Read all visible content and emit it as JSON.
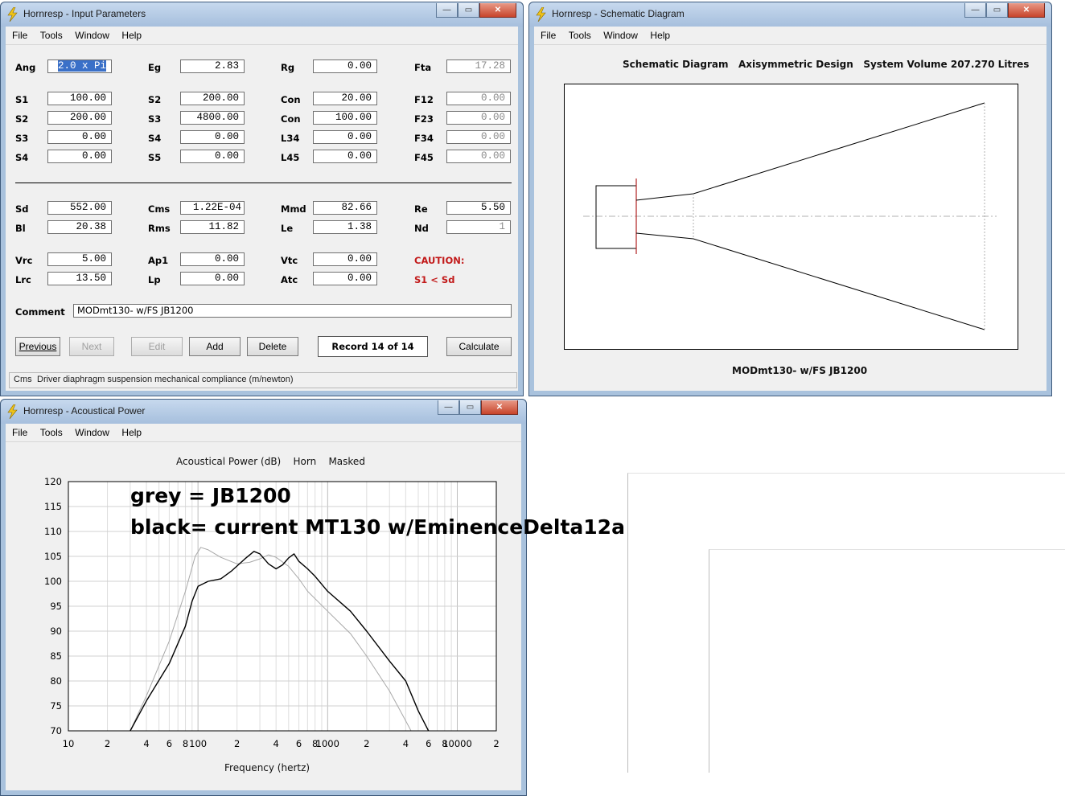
{
  "menu": [
    "File",
    "Tools",
    "Window",
    "Help"
  ],
  "window_buttons": {
    "minimize": "—",
    "maximize": "▭",
    "close": "✕"
  },
  "input_window": {
    "title": "Hornresp - Input Parameters",
    "fields": {
      "ang": {
        "label": "Ang",
        "value": "2.0 x Pi"
      },
      "eg": {
        "label": "Eg",
        "value": "2.83"
      },
      "rg": {
        "label": "Rg",
        "value": "0.00"
      },
      "fta": {
        "label": "Fta",
        "value": "17.28"
      },
      "s1": {
        "label": "S1",
        "value": "100.00"
      },
      "s2a": {
        "label": "S2",
        "value": "200.00"
      },
      "con1": {
        "label": "Con",
        "value": "20.00"
      },
      "f12": {
        "label": "F12",
        "value": "0.00"
      },
      "s2b": {
        "label": "S2",
        "value": "200.00"
      },
      "s3a": {
        "label": "S3",
        "value": "4800.00"
      },
      "con2": {
        "label": "Con",
        "value": "100.00"
      },
      "f23": {
        "label": "F23",
        "value": "0.00"
      },
      "s3b": {
        "label": "S3",
        "value": "0.00"
      },
      "s4a": {
        "label": "S4",
        "value": "0.00"
      },
      "l34": {
        "label": "L34",
        "value": "0.00"
      },
      "f34": {
        "label": "F34",
        "value": "0.00"
      },
      "s4b": {
        "label": "S4",
        "value": "0.00"
      },
      "s5": {
        "label": "S5",
        "value": "0.00"
      },
      "l45": {
        "label": "L45",
        "value": "0.00"
      },
      "f45": {
        "label": "F45",
        "value": "0.00"
      },
      "sd": {
        "label": "Sd",
        "value": "552.00"
      },
      "cms": {
        "label": "Cms",
        "value": "1.22E-04"
      },
      "mmd": {
        "label": "Mmd",
        "value": "82.66"
      },
      "re": {
        "label": "Re",
        "value": "5.50"
      },
      "bl": {
        "label": "Bl",
        "value": "20.38"
      },
      "rms": {
        "label": "Rms",
        "value": "11.82"
      },
      "le": {
        "label": "Le",
        "value": "1.38"
      },
      "nd": {
        "label": "Nd",
        "value": "1"
      },
      "vrc": {
        "label": "Vrc",
        "value": "5.00"
      },
      "ap1": {
        "label": "Ap1",
        "value": "0.00"
      },
      "vtc": {
        "label": "Vtc",
        "value": "0.00"
      },
      "lrc": {
        "label": "Lrc",
        "value": "13.50"
      },
      "lp": {
        "label": "Lp",
        "value": "0.00"
      },
      "atc": {
        "label": "Atc",
        "value": "0.00"
      }
    },
    "caution": {
      "title": "CAUTION:",
      "message": "S1 < Sd"
    },
    "comment": {
      "label": "Comment",
      "value": "MODmt130- w/FS JB1200"
    },
    "buttons": {
      "previous": "Previous",
      "next": "Next",
      "edit": "Edit",
      "add": "Add",
      "delete": "Delete",
      "calculate": "Calculate"
    },
    "record": "Record 14 of 14",
    "status": {
      "param": "Cms",
      "text": "Driver diaphragm suspension mechanical compliance  (m/newton)"
    }
  },
  "schematic_window": {
    "title": "Hornresp - Schematic Diagram",
    "heading": "Schematic Diagram   Axisymmetric Design   System Volume 207.270 Litres",
    "caption": "MODmt130- w/FS JB1200"
  },
  "power_window": {
    "title": "Hornresp - Acoustical Power",
    "heading": "Acoustical Power (dB)    Horn    Masked",
    "xlabel": "Frequency (hertz)"
  },
  "annotation": {
    "line1": "grey = JB1200",
    "line2": "black= current MT130 w/EminenceDelta12a"
  },
  "chart_data": {
    "type": "line",
    "title": "Acoustical Power (dB)    Horn    Masked",
    "xlabel": "Frequency (hertz)",
    "ylabel": "",
    "xscale": "log",
    "xlim": [
      10,
      20000
    ],
    "ylim": [
      70,
      120
    ],
    "y_ticks": [
      "120",
      "115",
      "110",
      "105",
      "100",
      "95",
      "90",
      "85",
      "80",
      "75",
      "70"
    ],
    "x_ticks": [
      {
        "f": 10,
        "label": "10"
      },
      {
        "f": 20,
        "label": "2"
      },
      {
        "f": 40,
        "label": "4"
      },
      {
        "f": 60,
        "label": "6"
      },
      {
        "f": 80,
        "label": "8"
      },
      {
        "f": 100,
        "label": "100"
      },
      {
        "f": 200,
        "label": "2"
      },
      {
        "f": 400,
        "label": "4"
      },
      {
        "f": 600,
        "label": "6"
      },
      {
        "f": 800,
        "label": "8"
      },
      {
        "f": 1000,
        "label": "1000"
      },
      {
        "f": 2000,
        "label": "2"
      },
      {
        "f": 4000,
        "label": "4"
      },
      {
        "f": 6000,
        "label": "6"
      },
      {
        "f": 8000,
        "label": "8"
      },
      {
        "f": 10000,
        "label": "10000"
      },
      {
        "f": 20000,
        "label": "2"
      }
    ],
    "grid": true,
    "series": [
      {
        "name": "JB1200",
        "color": "#a8a8a8",
        "points": [
          [
            30,
            70
          ],
          [
            40,
            77
          ],
          [
            60,
            88
          ],
          [
            80,
            98
          ],
          [
            95,
            105
          ],
          [
            105,
            106.8
          ],
          [
            120,
            106.3
          ],
          [
            150,
            104.8
          ],
          [
            200,
            103.5
          ],
          [
            250,
            103.8
          ],
          [
            300,
            104.5
          ],
          [
            350,
            105.3
          ],
          [
            400,
            104.8
          ],
          [
            500,
            103
          ],
          [
            600,
            100.5
          ],
          [
            700,
            98
          ],
          [
            1000,
            94
          ],
          [
            1500,
            89.5
          ],
          [
            2000,
            85
          ],
          [
            3000,
            78
          ],
          [
            4000,
            72
          ],
          [
            4400,
            70
          ]
        ]
      },
      {
        "name": "current MT130 w/EminenceDelta12a",
        "color": "#000000",
        "points": [
          [
            30,
            70
          ],
          [
            40,
            76
          ],
          [
            60,
            83.5
          ],
          [
            80,
            91
          ],
          [
            90,
            96
          ],
          [
            100,
            99
          ],
          [
            120,
            100
          ],
          [
            150,
            100.5
          ],
          [
            180,
            102
          ],
          [
            230,
            104.5
          ],
          [
            270,
            106
          ],
          [
            300,
            105.5
          ],
          [
            350,
            103.5
          ],
          [
            400,
            102.5
          ],
          [
            450,
            103.3
          ],
          [
            500,
            104.7
          ],
          [
            550,
            105.5
          ],
          [
            600,
            104
          ],
          [
            700,
            102.5
          ],
          [
            800,
            101
          ],
          [
            1000,
            98
          ],
          [
            1500,
            94
          ],
          [
            2000,
            90
          ],
          [
            3000,
            84
          ],
          [
            4000,
            80
          ],
          [
            5000,
            74
          ],
          [
            6000,
            70
          ]
        ]
      }
    ]
  }
}
